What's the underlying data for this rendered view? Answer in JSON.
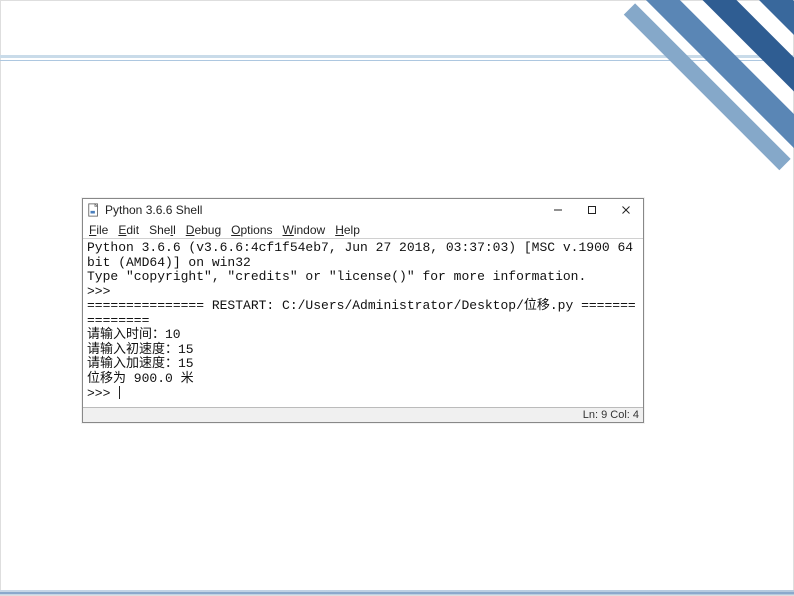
{
  "window": {
    "title": "Python 3.6.6 Shell",
    "minimize": "—",
    "maximize": "□",
    "close": "×"
  },
  "menu": {
    "file": "File",
    "edit": "Edit",
    "shell": "Shell",
    "debug": "Debug",
    "options": "Options",
    "window": "Window",
    "help": "Help"
  },
  "content": {
    "l1": "Python 3.6.6 (v3.6.6:4cf1f54eb7, Jun 27 2018, 03:37:03) [MSC v.1900 64",
    "l2": "bit (AMD64)] on win32",
    "l3": "Type \"copyright\", \"credits\" or \"license()\" for more information.",
    "l4": ">>> ",
    "l5": "=============== RESTART: C:/Users/Administrator/Desktop/位移.py =======",
    "l6": "========",
    "l7": "请输入时间：10",
    "l8": "请输入初速度：15",
    "l9": "请输入加速度：15",
    "l10": "位移为 900.0 米",
    "l11": ">>> "
  },
  "status": {
    "text": "Ln: 9  Col: 4"
  }
}
